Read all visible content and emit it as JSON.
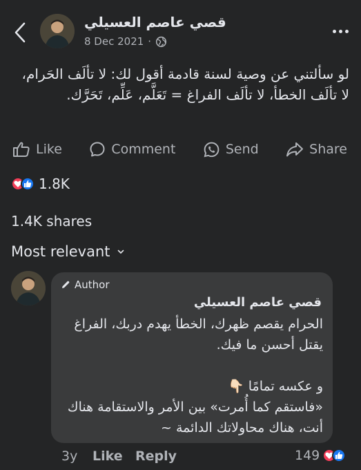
{
  "header": {
    "poster_name": "قصي عاصم العسيلي",
    "date": "8 Dec 2021",
    "separator": "·"
  },
  "post": {
    "text": "لو سألتني عن وصية لسنة قادمة أقول لك: لا تألَف الحَرام، لا تألَف الخطأ، لا تألَف الفراغ = تَعَلَّم، عَلِّم، تَحَرَّك."
  },
  "actions": {
    "like": "Like",
    "comment": "Comment",
    "send": "Send",
    "share": "Share"
  },
  "stats": {
    "reactions_count": "1.8K",
    "shares": "1.4K shares"
  },
  "comments": {
    "sort_label": "Most relevant",
    "items": [
      {
        "badge": "Author",
        "name": "قصي عاصم العسيلي",
        "text": "الحرام يقصم ظهرك، الخطأ يهدم دربك، الفراغ يقتل أحسن ما فيك.\n\nو عكسه تمامًا 👇🏻\n«فاستقم كما أُمرت» بين الأمر والاستقامة هناك أنت، هناك محاولاتك الدائمة ~",
        "age": "3y",
        "like": "Like",
        "reply": "Reply",
        "reaction_count": "149"
      }
    ]
  },
  "colors": {
    "background": "#242526",
    "bubble": "#3a3b3c",
    "text_primary": "#e4e6eb",
    "text_secondary": "#b0b3b8",
    "love": "#f33e58",
    "like": "#1877f2"
  }
}
